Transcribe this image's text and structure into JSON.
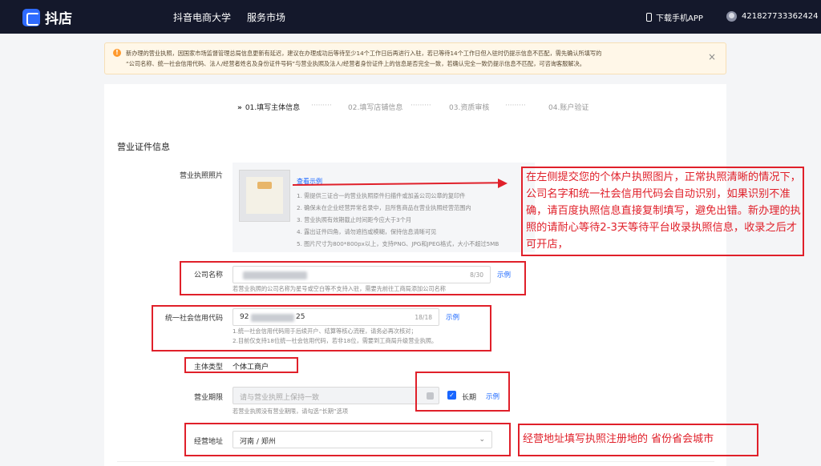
{
  "topbar": {
    "logo_text": "抖店",
    "nav": [
      "抖音电商大学",
      "服务市场"
    ],
    "download": "下载手机APP",
    "user_id": "421827733362424"
  },
  "notice": {
    "line1": "新办理的营业执照，因国家市场监督管理总局信息更新有延迟，建议在办理成功后等待至少14个工作日后再进行入驻，若已等待14个工作日但入驻时仍提示信息不匹配，需先确认所填写的",
    "line2": "“公司名称、统一社会信用代码、法人/经营者姓名及身份证件号码”与营业执照及法人/经营者身份证件上的信息是否完全一致，若确认完全一致仍提示信息不匹配，可咨询客服解决。",
    "close": "×"
  },
  "steps": [
    {
      "label": "01.填写主体信息",
      "arrow": "»"
    },
    {
      "label": "02.填写店铺信息"
    },
    {
      "label": "03.资质审核"
    },
    {
      "label": "04.账户验证"
    }
  ],
  "section_title": "营业证件信息",
  "license": {
    "label": "营业执照照片",
    "example_link": "查看示例",
    "tips": [
      "1. 需提供三证合一的营业执照原件扫描件或加盖公司公章的复印件",
      "2. 确保未在企业经营异常名录中，且所售商品在营业执照经营范围内",
      "3. 营业执照有效期截止时间距今应大于3个月",
      "4. 露出证件四角，请勿遮挡或模糊，保持信息清晰可见",
      "5. 图片尺寸为800*800px以上，支持PNG、JPG和JPEG格式，大小不超过5MB"
    ]
  },
  "company": {
    "label": "公司名称",
    "count": "8/30",
    "example": "示例",
    "hint": "若营业执照的公司名称为星号或空白等不支持入驻，需要先前往工商局添加公司名称"
  },
  "credit_code": {
    "label": "统一社会信用代码",
    "value_start": "92",
    "value_end": "25",
    "count": "18/18",
    "example": "示例",
    "hint1": "1.统一社会信用代码用于后续开户、结算等核心流程，请务必再次核对；",
    "hint2": "2.目前仅支持18位统一社会信用代码，若非18位，需要到工商局升级营业执照。"
  },
  "entity_type": {
    "label": "主体类型",
    "value": "个体工商户"
  },
  "period": {
    "label": "营业期限",
    "placeholder": "请与营业执照上保持一致",
    "check": "✓",
    "long_term": "长期",
    "example": "示例",
    "hint": "若营业执照没有营业期限，请勾选“长期”选项"
  },
  "address": {
    "label": "经营地址",
    "value": "河南 / 郑州",
    "chevron": "⌄"
  },
  "annotations": {
    "note1": "在左侧提交您的个体户执照图片，正常执照清晰的情况下，公司名字和统一社会信用代码会自动识别，如果识别不准确，请百度执照信息直接复制填写，避免出错。新办理的执照的请耐心等待2-3天等待平台收录执照信息，收录之后才可开店，",
    "note2": "经营地址填写执照注册地的 省份省会城市"
  },
  "colors": {
    "topbar_bg": "#14182b",
    "link": "#1966ff",
    "annotation_red": "#e0202a",
    "notice_bg": "#fff7e8"
  }
}
